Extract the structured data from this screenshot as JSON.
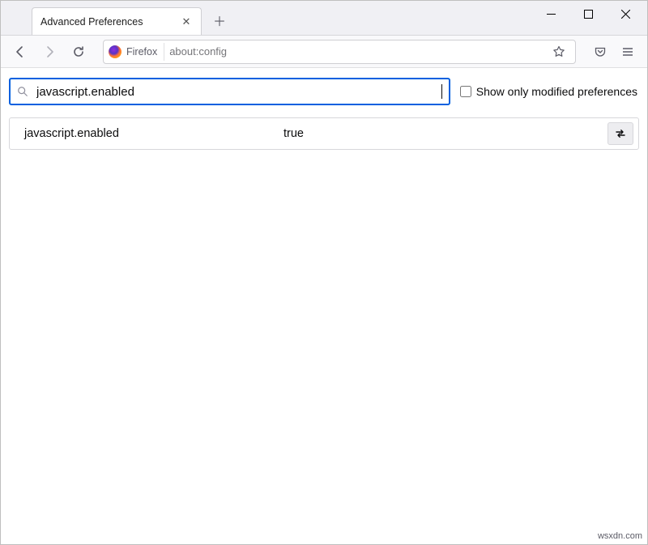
{
  "window": {
    "tab_title": "Advanced Preferences"
  },
  "urlbar": {
    "identity_label": "Firefox",
    "url": "about:config"
  },
  "config": {
    "search_value": "javascript.enabled",
    "filter_label": "Show only modified preferences",
    "filter_checked": false,
    "results": [
      {
        "name": "javascript.enabled",
        "value": "true"
      }
    ]
  },
  "watermark": "wsxdn.com"
}
